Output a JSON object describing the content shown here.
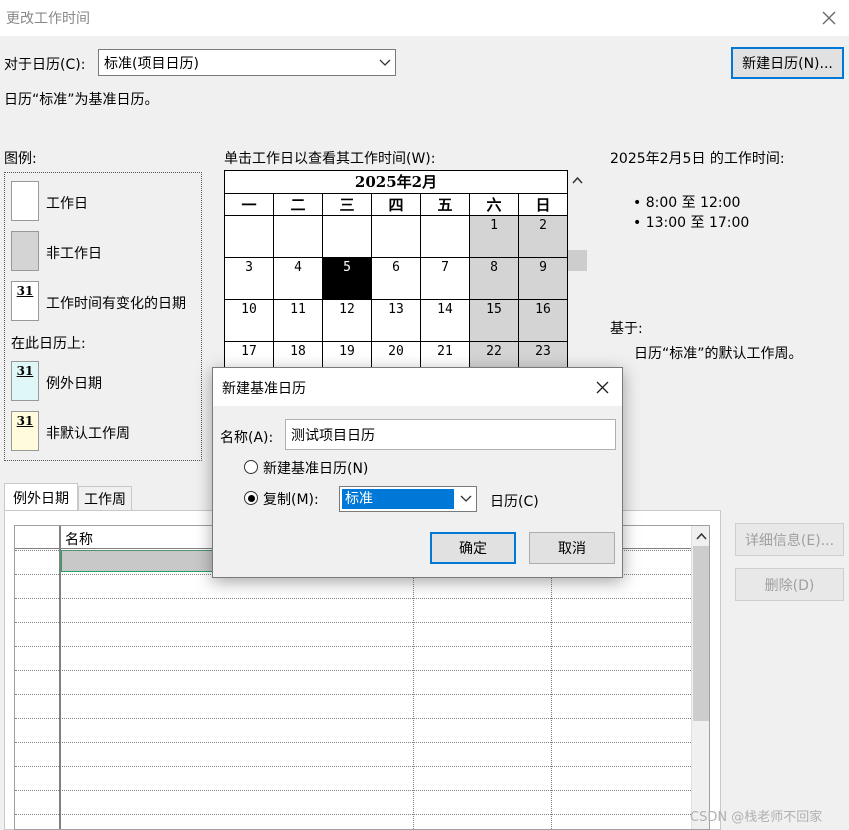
{
  "window": {
    "title": "更改工作时间"
  },
  "top": {
    "calendar_label": "对于日历(C):",
    "calendar_value": "标准(项目日历)",
    "new_calendar_button": "新建日历(N)...",
    "base_note": "日历“标准”为基准日历。"
  },
  "legend": {
    "title": "图例:",
    "items": [
      {
        "label": "工作日",
        "swatch": "#ffffff"
      },
      {
        "label": "非工作日",
        "swatch": "#d4d4d4"
      },
      {
        "label": "工作时间有变化的日期",
        "swatch": "#ffffff",
        "num": "31"
      }
    ],
    "on_calendar": "在此日历上:",
    "items2": [
      {
        "label": "例外日期",
        "swatch": "#dff7f7",
        "num": "31"
      },
      {
        "label": "非默认工作周",
        "swatch": "#fffbdc",
        "num": "31"
      }
    ]
  },
  "calendar": {
    "instruction": "单击工作日以查看其工作时间(W):",
    "month": "2025年2月",
    "weekdays": [
      "一",
      "二",
      "三",
      "四",
      "五",
      "六",
      "日"
    ],
    "weeks": [
      [
        "",
        "",
        "",
        "",
        "",
        "1",
        "2"
      ],
      [
        "3",
        "4",
        "5",
        "6",
        "7",
        "8",
        "9"
      ],
      [
        "10",
        "11",
        "12",
        "13",
        "14",
        "15",
        "16"
      ],
      [
        "17",
        "18",
        "19",
        "20",
        "21",
        "22",
        "23"
      ]
    ],
    "selected": "5"
  },
  "worktime": {
    "title": "2025年2月5日 的工作时间:",
    "slots": [
      "8:00 至 12:00",
      "13:00 至 17:00"
    ],
    "based_on_label": "基于:",
    "based_on_text": "日历“标准”的默认工作周。"
  },
  "tabs": [
    "例外日期",
    "工作周"
  ],
  "grid": {
    "col_name": "名称"
  },
  "side_buttons": {
    "details": "详细信息(E)...",
    "delete": "删除(D)"
  },
  "dialog": {
    "title": "新建基准日历",
    "name_label": "名称(A):",
    "name_value": "测试项目日历",
    "option_new": "新建基准日历(N)",
    "option_copy": "复制(M):",
    "copy_value": "标准",
    "copy_suffix": "日历(C)",
    "ok": "确定",
    "cancel": "取消"
  },
  "watermark": "CSDN @栈老师不回家"
}
